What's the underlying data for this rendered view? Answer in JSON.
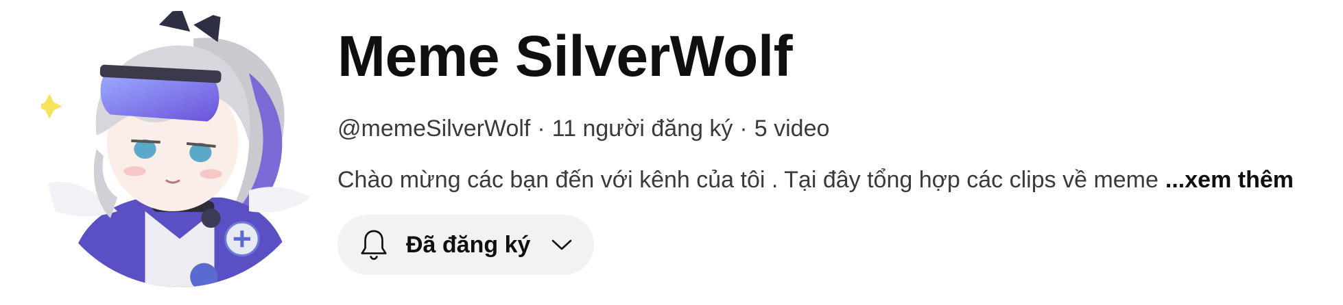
{
  "channel": {
    "name": "Meme SilverWolf",
    "handle": "@memeSilverWolf",
    "separator": "·",
    "subscribers": "11 người đăng ký",
    "videos": "5 video",
    "description": "Chào mừng các bạn đến với kênh của tôi . Tại đây tổng hợp các clips về meme",
    "more_label": "...xem thêm"
  },
  "subscribe": {
    "label": "Đã đăng ký",
    "icon": "bell-icon",
    "dropdown_icon": "chevron-down-icon"
  },
  "colors": {
    "button_bg": "#f2f2f2",
    "text_primary": "#0f0f0f",
    "text_secondary": "#3a3a3a"
  }
}
